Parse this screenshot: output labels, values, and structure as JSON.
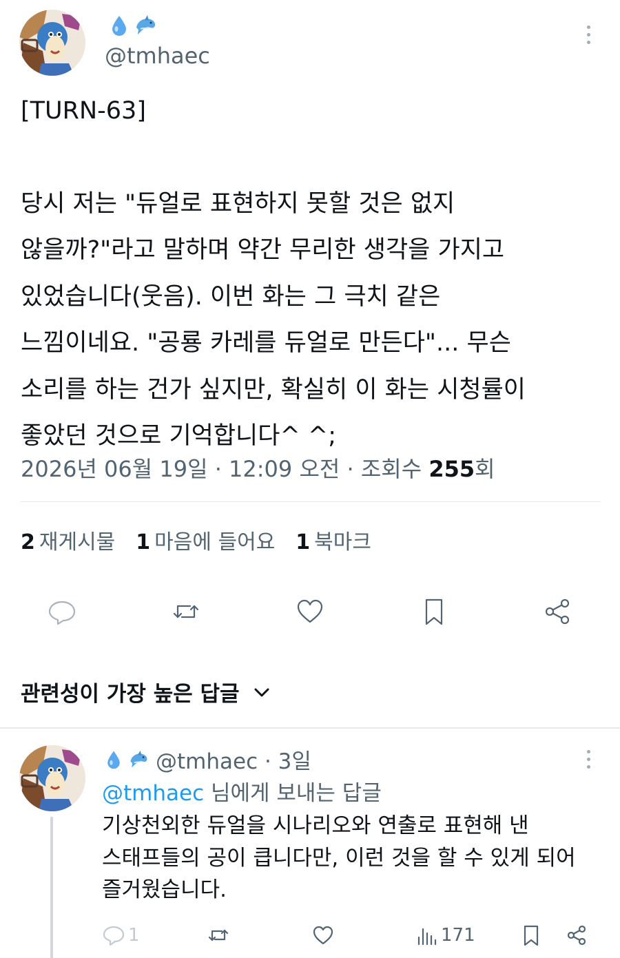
{
  "tweet": {
    "handle": "@tmhaec",
    "badges": [
      "droplet-emoji",
      "dolphin-emoji"
    ],
    "lines": [
      "[TURN-63]",
      "",
      "당시 저는 \"듀얼로 표현하지 못할 것은 없지",
      "않을까?\"라고 말하며 약간 무리한 생각을 가지고",
      "있었습니다(웃음). 이번 화는 그 극치 같은",
      "느낌이네요. \"공룡 카레를 듀얼로 만든다\"... 무슨",
      "소리를 하는 건가 싶지만, 확실히 이 화는 시청률이",
      "좋았던 것으로 기억합니다^ ^;"
    ],
    "date": "2026년 06월 19일 · 12:09 오전 · 조회수 ",
    "views": "255",
    "views_suffix": "회"
  },
  "stats": {
    "retweets_count": "2",
    "retweets_label": "재게시물",
    "likes_count": "1",
    "likes_label": "마음에 들어요",
    "bookmarks_count": "1",
    "bookmarks_label": "북마크"
  },
  "actions_icons": [
    "reply-icon",
    "retweet-icon",
    "like-icon",
    "bookmark-icon",
    "share-icon"
  ],
  "replies_header": {
    "label": "관련성이 가장 높은 답글"
  },
  "reply": {
    "handle": "@tmhaec · 3일",
    "replying_to_mention": "@tmhaec",
    "replying_to_suffix": " 님에게 보내는 답글",
    "lines": [
      "기상천외한 듀얼을 시나리오와 연출로 표현해 낸",
      "스태프들의 공이 큽니다만, 이런 것을 할 수 있게 되어",
      "즐거웠습니다."
    ],
    "reply_count": "1",
    "view_count": "171"
  },
  "colors": {
    "text": "#0f1419",
    "secondary": "#536471",
    "link": "#1d9bf0",
    "divider": "#e6e9ec"
  }
}
